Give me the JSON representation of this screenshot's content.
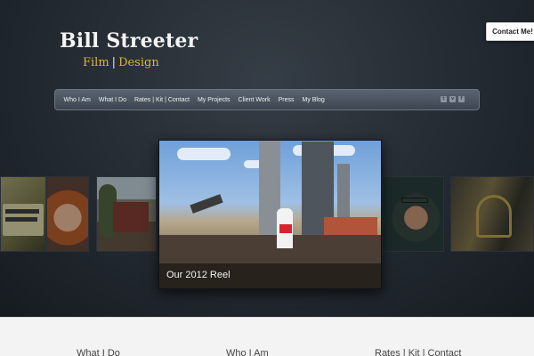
{
  "site": {
    "title": "Bill Streeter",
    "subtitle_left": "Film",
    "subtitle_sep": "|",
    "subtitle_right": "Design"
  },
  "contact_button": "Contact Me!",
  "nav": {
    "items": [
      "Who I Am",
      "What I Do",
      "Rates | Kit | Contact",
      "My Projects",
      "Client Work",
      "Press",
      "My Blog"
    ],
    "social_icons": [
      "twitter-icon",
      "vimeo-icon",
      "facebook-icon"
    ]
  },
  "featured": {
    "caption": "Our 2012 Reel"
  },
  "footer_links": [
    "What I Do",
    "Who I Am",
    "Rates | Kit | Contact"
  ],
  "colors": {
    "accent_gold": "#d8b93a",
    "hero_bg": "#232a31",
    "nav_bg": "#4a535e"
  }
}
